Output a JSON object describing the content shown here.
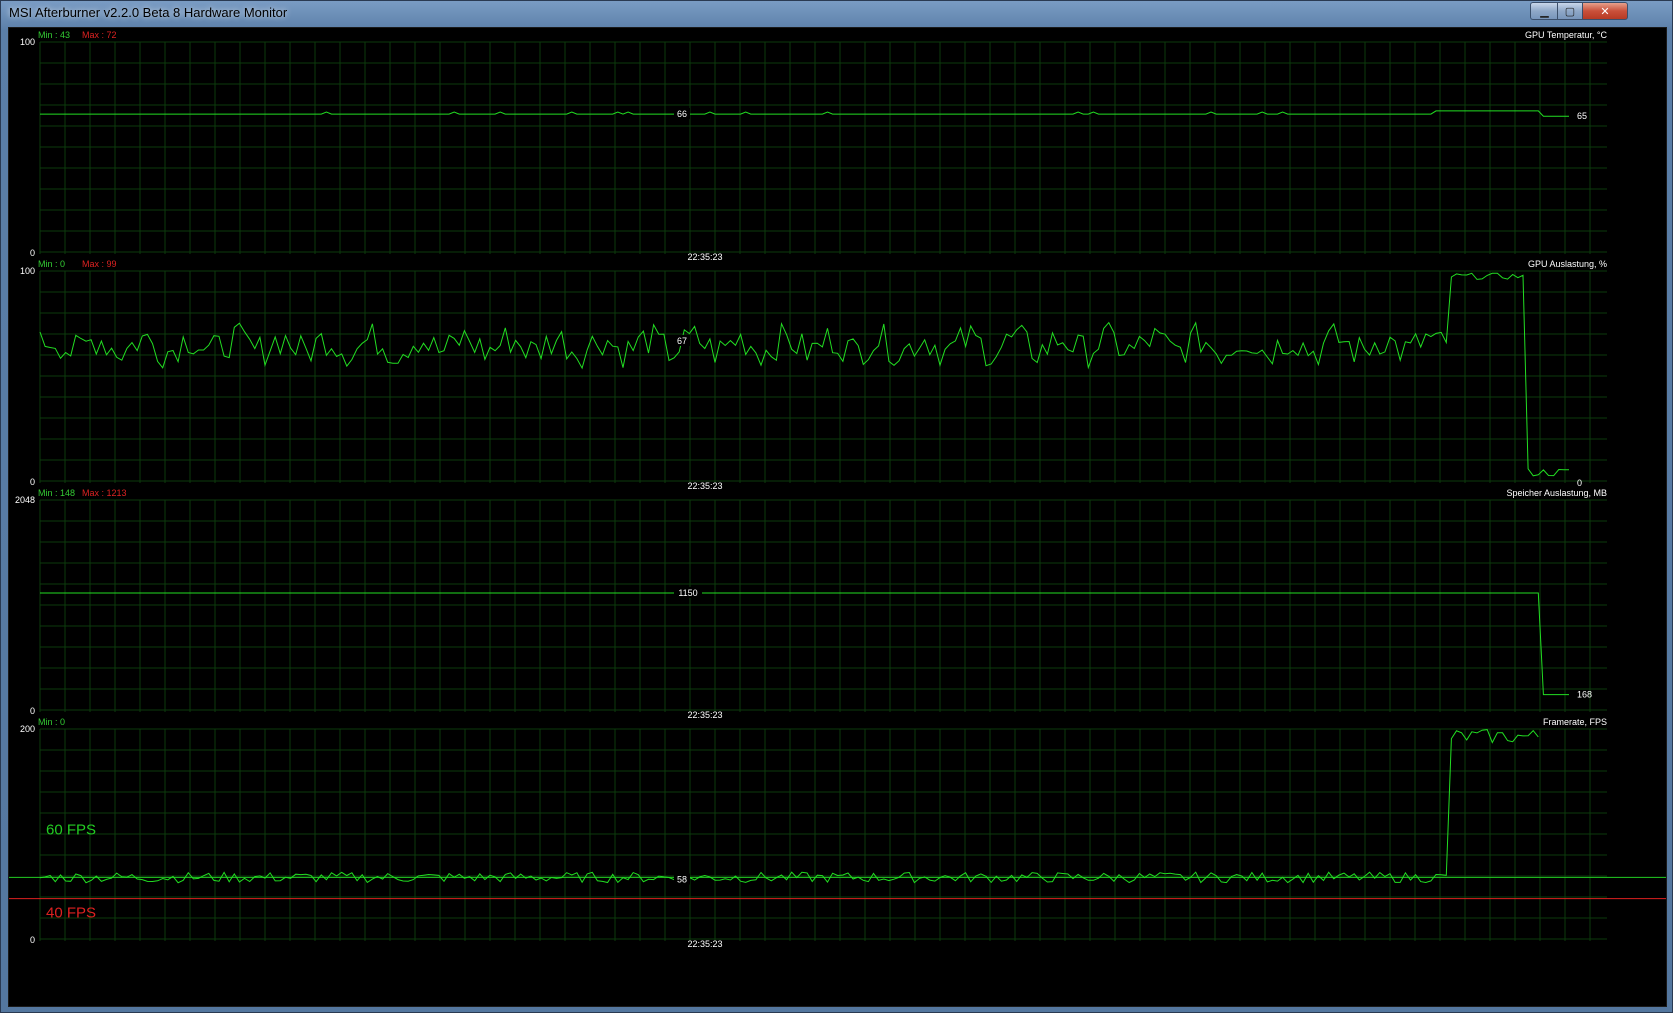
{
  "window": {
    "title": "MSI Afterburner v2.2.0 Beta 8 Hardware Monitor",
    "controls": {
      "minimize": "▁",
      "maximize": "▢",
      "close": "✕"
    }
  },
  "colors": {
    "background": "#000000",
    "grid": "#0c3a0c",
    "line": "#22dd22",
    "min_text": "#33cc33",
    "max_text": "#dd2222",
    "label": "#ffffff",
    "fps60": "#22cc22",
    "fps40": "#dd2020"
  },
  "graphs": [
    {
      "title": "GPU Temperatur, °C",
      "min_label": "Min : 43",
      "max_label": "Max : 72",
      "y_top": "100",
      "y_bottom": "0",
      "time_label": "22:35:23",
      "center_value": "66",
      "current_value": "65",
      "range": [
        0,
        100
      ]
    },
    {
      "title": "GPU Auslastung, %",
      "min_label": "Min : 0",
      "max_label": "Max : 99",
      "y_top": "100",
      "y_bottom": "0",
      "time_label": "22:35:23",
      "center_value": "67",
      "current_value": "0",
      "range": [
        0,
        100
      ]
    },
    {
      "title": "Speicher Auslastung, MB",
      "min_label": "Min : 148",
      "max_label": "Max : 1213",
      "y_top": "2048",
      "y_bottom": "0",
      "time_label": "22:35:23",
      "center_value": "1150",
      "current_value": "168",
      "range": [
        0,
        2048
      ]
    },
    {
      "title": "Framerate, FPS",
      "min_label": "Min : 0",
      "max_label": "",
      "y_top": "200",
      "y_bottom": "0",
      "time_label": "22:35:23",
      "center_value": "58",
      "current_value": "",
      "range": [
        0,
        200
      ],
      "reference_lines": [
        {
          "label": "60 FPS",
          "value": 60,
          "color": "#22cc22"
        },
        {
          "label": "40 FPS",
          "value": 40,
          "color": "#dd2020"
        }
      ]
    }
  ]
}
